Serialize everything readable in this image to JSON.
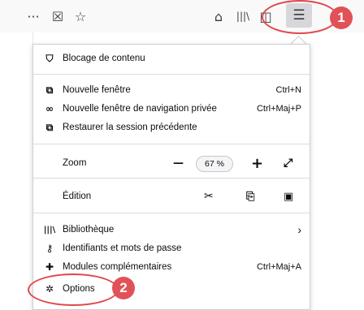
{
  "toolbar": {
    "icons": {
      "more": "···",
      "pocket": "☒",
      "bookmark": "☆",
      "downloads": "⌂",
      "library": "|||\\",
      "sidebar": "◫",
      "menu": "☰"
    }
  },
  "callouts": [
    "1",
    "2"
  ],
  "menu": {
    "content_blocking": "Blocage de contenu",
    "new_window": "Nouvelle fenêtre",
    "new_window_shortcut": "Ctrl+N",
    "private_window": "Nouvelle fenêtre de navigation privée",
    "private_window_shortcut": "Ctrl+Maj+P",
    "restore_session": "Restaurer la session précédente",
    "zoom_label": "Zoom",
    "zoom_minus": "—",
    "zoom_value": "67 %",
    "zoom_plus": "+",
    "zoom_fullscreen": "⤢",
    "edit_label": "Édition",
    "cut": "✂",
    "copy": "⎘",
    "paste": "▣",
    "library": "Bibliothèque",
    "library_arrow": "›",
    "logins": "Identifiants et mots de passe",
    "addons": "Modules complémentaires",
    "addons_shortcut": "Ctrl+Maj+A",
    "options": "Options"
  },
  "colors": {
    "accent_red": "#e05257",
    "toolbar_bg": "#f9f9fa",
    "panel_border": "#cfcfd3"
  }
}
